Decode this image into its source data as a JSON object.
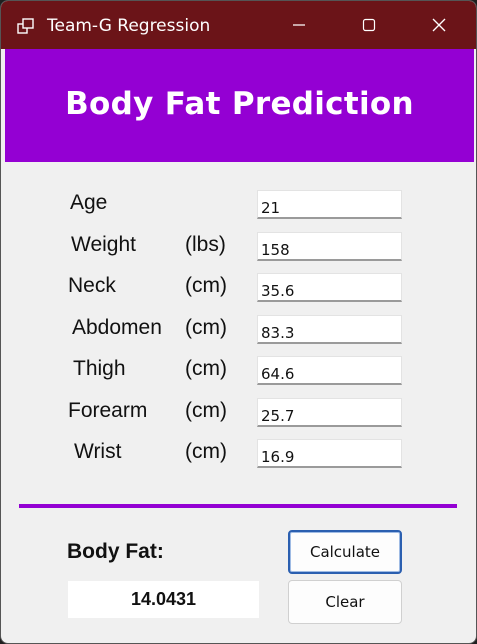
{
  "window": {
    "title": "Team-G Regression"
  },
  "banner": {
    "title": "Body Fat Prediction",
    "color": "#9400d3"
  },
  "form": {
    "fields": [
      {
        "label": "Age",
        "unit": "",
        "value": "21"
      },
      {
        "label": "Weight",
        "unit": "(lbs)",
        "value": "158"
      },
      {
        "label": "Neck",
        "unit": "(cm)",
        "value": "35.6"
      },
      {
        "label": "Abdomen",
        "unit": "(cm)",
        "value": "83.3"
      },
      {
        "label": "Thigh",
        "unit": "(cm)",
        "value": "64.6"
      },
      {
        "label": "Forearm",
        "unit": "(cm)",
        "value": "25.7"
      },
      {
        "label": "Wrist",
        "unit": "(cm)",
        "value": "16.9"
      }
    ]
  },
  "result": {
    "label": "Body Fat:",
    "value": "14.0431"
  },
  "buttons": {
    "calculate": "Calculate",
    "clear": "Clear"
  },
  "colors": {
    "titlebar": "#6b1418",
    "accent": "#9400d3",
    "focus_border": "#2b5fb0"
  }
}
